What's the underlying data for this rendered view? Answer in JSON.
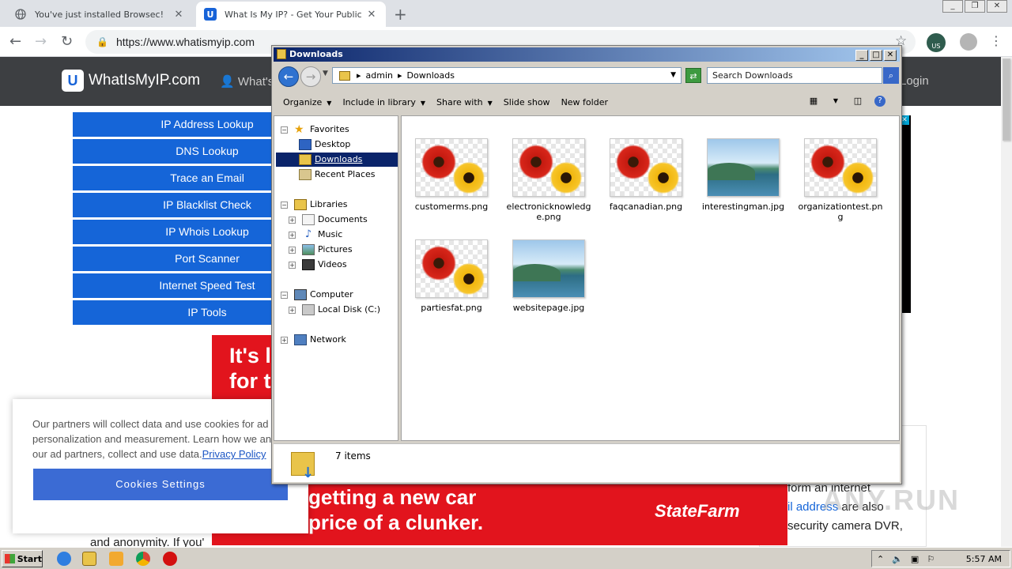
{
  "browser": {
    "tabs": [
      {
        "title": "You've just installed Browsec!",
        "active": false
      },
      {
        "title": "What Is My IP? - Get Your Public IP a",
        "active": true
      }
    ],
    "url": "https://www.whatismyip.com",
    "extension_badge": "US"
  },
  "site": {
    "logo": "WhatIsMyIP.com",
    "header_link": "What's",
    "login": "Login",
    "menu": [
      "IP Address Lookup",
      "DNS Lookup",
      "Trace an Email",
      "IP Blacklist Check",
      "IP Whois Lookup",
      "Port Scanner",
      "Internet Speed Test",
      "IP Tools"
    ],
    "ad_top": {
      "line1": "It's l",
      "line2": "for t"
    },
    "ad_bottom": {
      "line1": "getting a new car",
      "line2": "price of a clunker.",
      "brand": "StateFarm"
    },
    "article": {
      "line1": "form an internet",
      "link": "il address",
      "line2_rest": " are also",
      "line3": "security camera DVR,"
    },
    "page_text": "and anonymity. If you'",
    "watermark": "ANY.RUN"
  },
  "cookie_banner": {
    "line1": "Our partners will collect data and use cookies for ad",
    "line2": "personalization and measurement. Learn how we an",
    "line3": "our ad partners, collect and use data.",
    "privacy_link": "Privacy Policy",
    "button": "Cookies Settings"
  },
  "explorer": {
    "title": "Downloads",
    "breadcrumb": [
      "admin",
      "Downloads"
    ],
    "search_placeholder": "Search Downloads",
    "commands": [
      "Organize",
      "Include in library",
      "Share with",
      "Slide show",
      "New folder"
    ],
    "nav": {
      "favorites": "Favorites",
      "desktop": "Desktop",
      "downloads": "Downloads",
      "recent": "Recent Places",
      "libraries": "Libraries",
      "documents": "Documents",
      "music": "Music",
      "pictures": "Pictures",
      "videos": "Videos",
      "computer": "Computer",
      "local_disk": "Local Disk (C:)",
      "network": "Network"
    },
    "files": [
      {
        "name": "customerms.png",
        "type": "flowers"
      },
      {
        "name": "electronicknowledge.png",
        "type": "flowers"
      },
      {
        "name": "faqcanadian.png",
        "type": "flowers"
      },
      {
        "name": "interestingman.jpg",
        "type": "landscape"
      },
      {
        "name": "organizationtest.png",
        "type": "flowers"
      },
      {
        "name": "partiesfat.png",
        "type": "flowers"
      },
      {
        "name": "websitepage.jpg",
        "type": "landscape"
      }
    ],
    "status": "7 items"
  },
  "taskbar": {
    "start": "Start",
    "clock": "5:57 AM"
  }
}
